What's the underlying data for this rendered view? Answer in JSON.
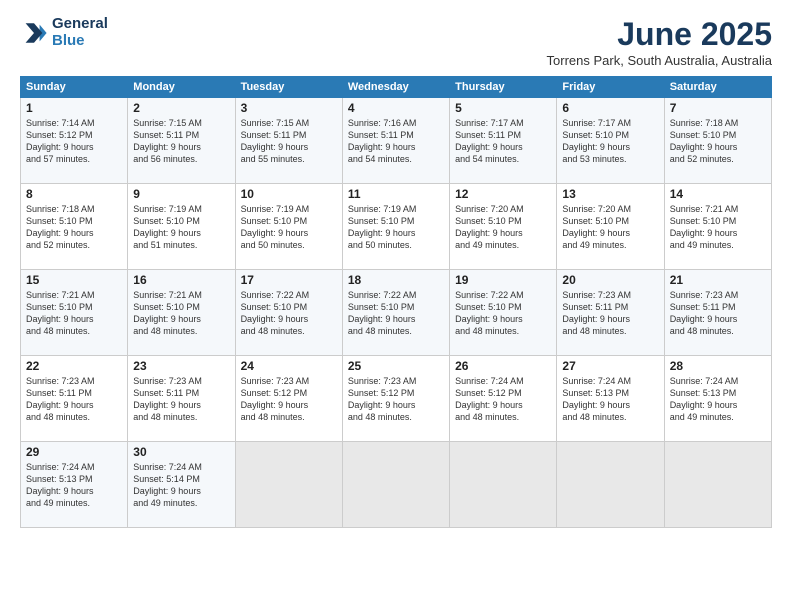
{
  "header": {
    "logo_line1": "General",
    "logo_line2": "Blue",
    "month": "June 2025",
    "location": "Torrens Park, South Australia, Australia"
  },
  "weekdays": [
    "Sunday",
    "Monday",
    "Tuesday",
    "Wednesday",
    "Thursday",
    "Friday",
    "Saturday"
  ],
  "weeks": [
    [
      {
        "day": "1",
        "info": "Sunrise: 7:14 AM\nSunset: 5:12 PM\nDaylight: 9 hours\nand 57 minutes."
      },
      {
        "day": "2",
        "info": "Sunrise: 7:15 AM\nSunset: 5:11 PM\nDaylight: 9 hours\nand 56 minutes."
      },
      {
        "day": "3",
        "info": "Sunrise: 7:15 AM\nSunset: 5:11 PM\nDaylight: 9 hours\nand 55 minutes."
      },
      {
        "day": "4",
        "info": "Sunrise: 7:16 AM\nSunset: 5:11 PM\nDaylight: 9 hours\nand 54 minutes."
      },
      {
        "day": "5",
        "info": "Sunrise: 7:17 AM\nSunset: 5:11 PM\nDaylight: 9 hours\nand 54 minutes."
      },
      {
        "day": "6",
        "info": "Sunrise: 7:17 AM\nSunset: 5:10 PM\nDaylight: 9 hours\nand 53 minutes."
      },
      {
        "day": "7",
        "info": "Sunrise: 7:18 AM\nSunset: 5:10 PM\nDaylight: 9 hours\nand 52 minutes."
      }
    ],
    [
      {
        "day": "8",
        "info": "Sunrise: 7:18 AM\nSunset: 5:10 PM\nDaylight: 9 hours\nand 52 minutes."
      },
      {
        "day": "9",
        "info": "Sunrise: 7:19 AM\nSunset: 5:10 PM\nDaylight: 9 hours\nand 51 minutes."
      },
      {
        "day": "10",
        "info": "Sunrise: 7:19 AM\nSunset: 5:10 PM\nDaylight: 9 hours\nand 50 minutes."
      },
      {
        "day": "11",
        "info": "Sunrise: 7:19 AM\nSunset: 5:10 PM\nDaylight: 9 hours\nand 50 minutes."
      },
      {
        "day": "12",
        "info": "Sunrise: 7:20 AM\nSunset: 5:10 PM\nDaylight: 9 hours\nand 49 minutes."
      },
      {
        "day": "13",
        "info": "Sunrise: 7:20 AM\nSunset: 5:10 PM\nDaylight: 9 hours\nand 49 minutes."
      },
      {
        "day": "14",
        "info": "Sunrise: 7:21 AM\nSunset: 5:10 PM\nDaylight: 9 hours\nand 49 minutes."
      }
    ],
    [
      {
        "day": "15",
        "info": "Sunrise: 7:21 AM\nSunset: 5:10 PM\nDaylight: 9 hours\nand 48 minutes."
      },
      {
        "day": "16",
        "info": "Sunrise: 7:21 AM\nSunset: 5:10 PM\nDaylight: 9 hours\nand 48 minutes."
      },
      {
        "day": "17",
        "info": "Sunrise: 7:22 AM\nSunset: 5:10 PM\nDaylight: 9 hours\nand 48 minutes."
      },
      {
        "day": "18",
        "info": "Sunrise: 7:22 AM\nSunset: 5:10 PM\nDaylight: 9 hours\nand 48 minutes."
      },
      {
        "day": "19",
        "info": "Sunrise: 7:22 AM\nSunset: 5:10 PM\nDaylight: 9 hours\nand 48 minutes."
      },
      {
        "day": "20",
        "info": "Sunrise: 7:23 AM\nSunset: 5:11 PM\nDaylight: 9 hours\nand 48 minutes."
      },
      {
        "day": "21",
        "info": "Sunrise: 7:23 AM\nSunset: 5:11 PM\nDaylight: 9 hours\nand 48 minutes."
      }
    ],
    [
      {
        "day": "22",
        "info": "Sunrise: 7:23 AM\nSunset: 5:11 PM\nDaylight: 9 hours\nand 48 minutes."
      },
      {
        "day": "23",
        "info": "Sunrise: 7:23 AM\nSunset: 5:11 PM\nDaylight: 9 hours\nand 48 minutes."
      },
      {
        "day": "24",
        "info": "Sunrise: 7:23 AM\nSunset: 5:12 PM\nDaylight: 9 hours\nand 48 minutes."
      },
      {
        "day": "25",
        "info": "Sunrise: 7:23 AM\nSunset: 5:12 PM\nDaylight: 9 hours\nand 48 minutes."
      },
      {
        "day": "26",
        "info": "Sunrise: 7:24 AM\nSunset: 5:12 PM\nDaylight: 9 hours\nand 48 minutes."
      },
      {
        "day": "27",
        "info": "Sunrise: 7:24 AM\nSunset: 5:13 PM\nDaylight: 9 hours\nand 48 minutes."
      },
      {
        "day": "28",
        "info": "Sunrise: 7:24 AM\nSunset: 5:13 PM\nDaylight: 9 hours\nand 49 minutes."
      }
    ],
    [
      {
        "day": "29",
        "info": "Sunrise: 7:24 AM\nSunset: 5:13 PM\nDaylight: 9 hours\nand 49 minutes."
      },
      {
        "day": "30",
        "info": "Sunrise: 7:24 AM\nSunset: 5:14 PM\nDaylight: 9 hours\nand 49 minutes."
      },
      {
        "day": "",
        "info": ""
      },
      {
        "day": "",
        "info": ""
      },
      {
        "day": "",
        "info": ""
      },
      {
        "day": "",
        "info": ""
      },
      {
        "day": "",
        "info": ""
      }
    ]
  ]
}
